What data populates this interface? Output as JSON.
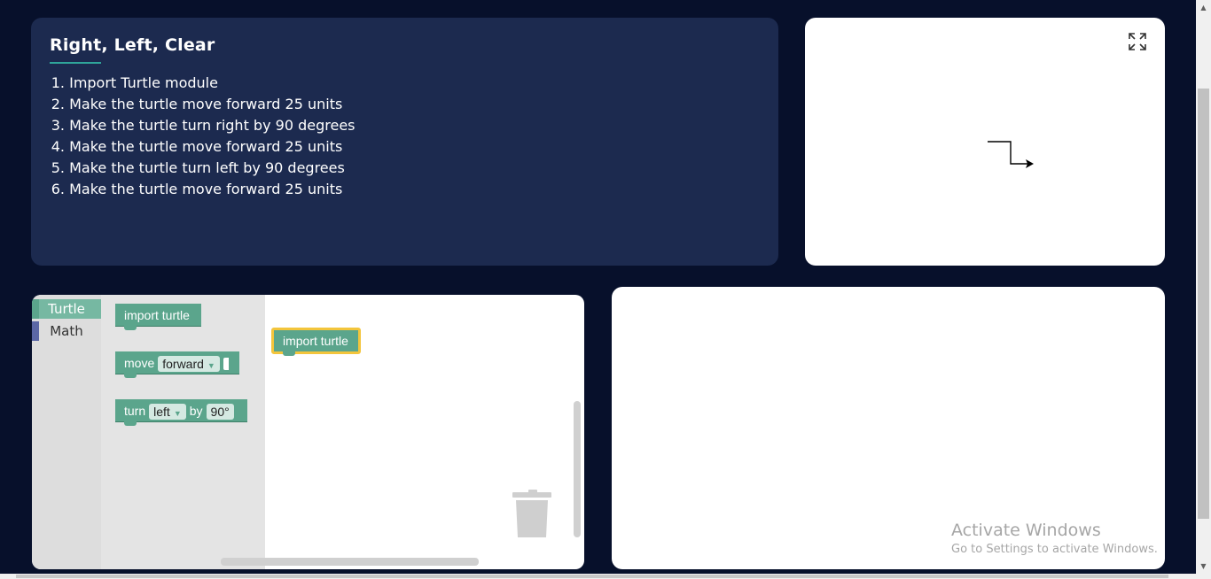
{
  "task": {
    "title": "Right, Left, Clear",
    "steps": [
      {
        "num": "1.",
        "text": "Import Turtle module"
      },
      {
        "num": "2.",
        "text": "Make the turtle move forward 25 units"
      },
      {
        "num": "3.",
        "text": "Make the turtle turn right by 90 degrees"
      },
      {
        "num": "4.",
        "text": "Make the turtle move forward 25 units"
      },
      {
        "num": "5.",
        "text": "Make the turtle turn left by 90 degrees"
      },
      {
        "num": "6.",
        "text": "Make the turtle move forward 25 units"
      }
    ]
  },
  "canvas": {
    "expand_icon": "expand-icon",
    "stroke_color": "#000000"
  },
  "toolbox": {
    "categories": [
      {
        "label": "Turtle",
        "color": "#5ba58c"
      },
      {
        "label": "Math",
        "color": "#5b67a5"
      }
    ]
  },
  "flyout": {
    "import_block": "import turtle",
    "move_block": {
      "label": "move",
      "dropdown": "forward"
    },
    "turn_block": {
      "label": "turn",
      "dropdown": "left",
      "by": "by",
      "angle": "90°"
    }
  },
  "workspace": {
    "blocks": [
      {
        "label": "import turtle",
        "selected": true
      }
    ],
    "trash_icon": "trash-icon"
  },
  "watermark": {
    "title": "Activate Windows",
    "subtitle": "Go to Settings to activate Windows."
  },
  "colors": {
    "background": "#07102b",
    "task_panel": "#1c2a4f",
    "accent": "#2fa59a",
    "block": "#5ba58c",
    "selection": "#f3c53c"
  }
}
